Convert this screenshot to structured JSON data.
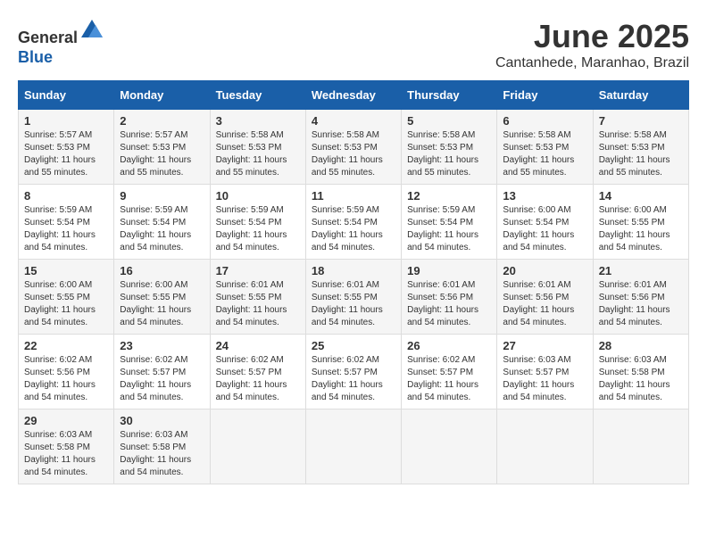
{
  "logo": {
    "general": "General",
    "blue": "Blue"
  },
  "header": {
    "title": "June 2025",
    "subtitle": "Cantanhede, Maranhao, Brazil"
  },
  "weekdays": [
    "Sunday",
    "Monday",
    "Tuesday",
    "Wednesday",
    "Thursday",
    "Friday",
    "Saturday"
  ],
  "weeks": [
    [
      {
        "day": "1",
        "sunrise": "5:57 AM",
        "sunset": "5:53 PM",
        "daylight": "11 hours and 55 minutes."
      },
      {
        "day": "2",
        "sunrise": "5:57 AM",
        "sunset": "5:53 PM",
        "daylight": "11 hours and 55 minutes."
      },
      {
        "day": "3",
        "sunrise": "5:58 AM",
        "sunset": "5:53 PM",
        "daylight": "11 hours and 55 minutes."
      },
      {
        "day": "4",
        "sunrise": "5:58 AM",
        "sunset": "5:53 PM",
        "daylight": "11 hours and 55 minutes."
      },
      {
        "day": "5",
        "sunrise": "5:58 AM",
        "sunset": "5:53 PM",
        "daylight": "11 hours and 55 minutes."
      },
      {
        "day": "6",
        "sunrise": "5:58 AM",
        "sunset": "5:53 PM",
        "daylight": "11 hours and 55 minutes."
      },
      {
        "day": "7",
        "sunrise": "5:58 AM",
        "sunset": "5:53 PM",
        "daylight": "11 hours and 55 minutes."
      }
    ],
    [
      {
        "day": "8",
        "sunrise": "5:59 AM",
        "sunset": "5:54 PM",
        "daylight": "11 hours and 54 minutes."
      },
      {
        "day": "9",
        "sunrise": "5:59 AM",
        "sunset": "5:54 PM",
        "daylight": "11 hours and 54 minutes."
      },
      {
        "day": "10",
        "sunrise": "5:59 AM",
        "sunset": "5:54 PM",
        "daylight": "11 hours and 54 minutes."
      },
      {
        "day": "11",
        "sunrise": "5:59 AM",
        "sunset": "5:54 PM",
        "daylight": "11 hours and 54 minutes."
      },
      {
        "day": "12",
        "sunrise": "5:59 AM",
        "sunset": "5:54 PM",
        "daylight": "11 hours and 54 minutes."
      },
      {
        "day": "13",
        "sunrise": "6:00 AM",
        "sunset": "5:54 PM",
        "daylight": "11 hours and 54 minutes."
      },
      {
        "day": "14",
        "sunrise": "6:00 AM",
        "sunset": "5:55 PM",
        "daylight": "11 hours and 54 minutes."
      }
    ],
    [
      {
        "day": "15",
        "sunrise": "6:00 AM",
        "sunset": "5:55 PM",
        "daylight": "11 hours and 54 minutes."
      },
      {
        "day": "16",
        "sunrise": "6:00 AM",
        "sunset": "5:55 PM",
        "daylight": "11 hours and 54 minutes."
      },
      {
        "day": "17",
        "sunrise": "6:01 AM",
        "sunset": "5:55 PM",
        "daylight": "11 hours and 54 minutes."
      },
      {
        "day": "18",
        "sunrise": "6:01 AM",
        "sunset": "5:55 PM",
        "daylight": "11 hours and 54 minutes."
      },
      {
        "day": "19",
        "sunrise": "6:01 AM",
        "sunset": "5:56 PM",
        "daylight": "11 hours and 54 minutes."
      },
      {
        "day": "20",
        "sunrise": "6:01 AM",
        "sunset": "5:56 PM",
        "daylight": "11 hours and 54 minutes."
      },
      {
        "day": "21",
        "sunrise": "6:01 AM",
        "sunset": "5:56 PM",
        "daylight": "11 hours and 54 minutes."
      }
    ],
    [
      {
        "day": "22",
        "sunrise": "6:02 AM",
        "sunset": "5:56 PM",
        "daylight": "11 hours and 54 minutes."
      },
      {
        "day": "23",
        "sunrise": "6:02 AM",
        "sunset": "5:57 PM",
        "daylight": "11 hours and 54 minutes."
      },
      {
        "day": "24",
        "sunrise": "6:02 AM",
        "sunset": "5:57 PM",
        "daylight": "11 hours and 54 minutes."
      },
      {
        "day": "25",
        "sunrise": "6:02 AM",
        "sunset": "5:57 PM",
        "daylight": "11 hours and 54 minutes."
      },
      {
        "day": "26",
        "sunrise": "6:02 AM",
        "sunset": "5:57 PM",
        "daylight": "11 hours and 54 minutes."
      },
      {
        "day": "27",
        "sunrise": "6:03 AM",
        "sunset": "5:57 PM",
        "daylight": "11 hours and 54 minutes."
      },
      {
        "day": "28",
        "sunrise": "6:03 AM",
        "sunset": "5:58 PM",
        "daylight": "11 hours and 54 minutes."
      }
    ],
    [
      {
        "day": "29",
        "sunrise": "6:03 AM",
        "sunset": "5:58 PM",
        "daylight": "11 hours and 54 minutes."
      },
      {
        "day": "30",
        "sunrise": "6:03 AM",
        "sunset": "5:58 PM",
        "daylight": "11 hours and 54 minutes."
      },
      null,
      null,
      null,
      null,
      null
    ]
  ],
  "labels": {
    "sunrise": "Sunrise: ",
    "sunset": "Sunset: ",
    "daylight": "Daylight: "
  }
}
